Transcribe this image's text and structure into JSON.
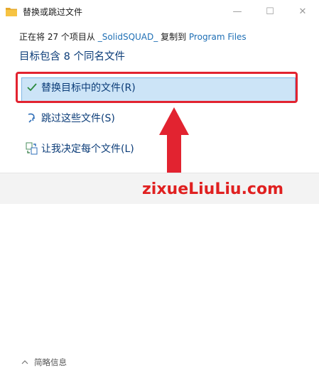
{
  "window": {
    "title": "替换或跳过文件"
  },
  "titlebar": {
    "minimize_glyph": "—",
    "maximize_glyph": "☐",
    "close_glyph": "✕"
  },
  "status": {
    "prefix": "正在将 27 个项目从 ",
    "source": "_SolidSQUAD_",
    "middle": " 复制到 ",
    "destination": "Program Files"
  },
  "heading": "目标包含 8 个同名文件",
  "options": [
    {
      "label": "替换目标中的文件(R)",
      "icon": "check-icon",
      "selected": true
    },
    {
      "label": "跳过这些文件(S)",
      "icon": "skip-icon",
      "selected": false
    },
    {
      "label": "让我决定每个文件(L)",
      "icon": "decide-icon",
      "selected": false
    }
  ],
  "footer": {
    "details_label": "简略信息"
  },
  "watermark": "zixueLiuLiu.com",
  "colors": {
    "accent": "#0b3c78",
    "link": "#1f6fb5",
    "selection": "#cce4f7",
    "annotation_red": "#e22330"
  }
}
